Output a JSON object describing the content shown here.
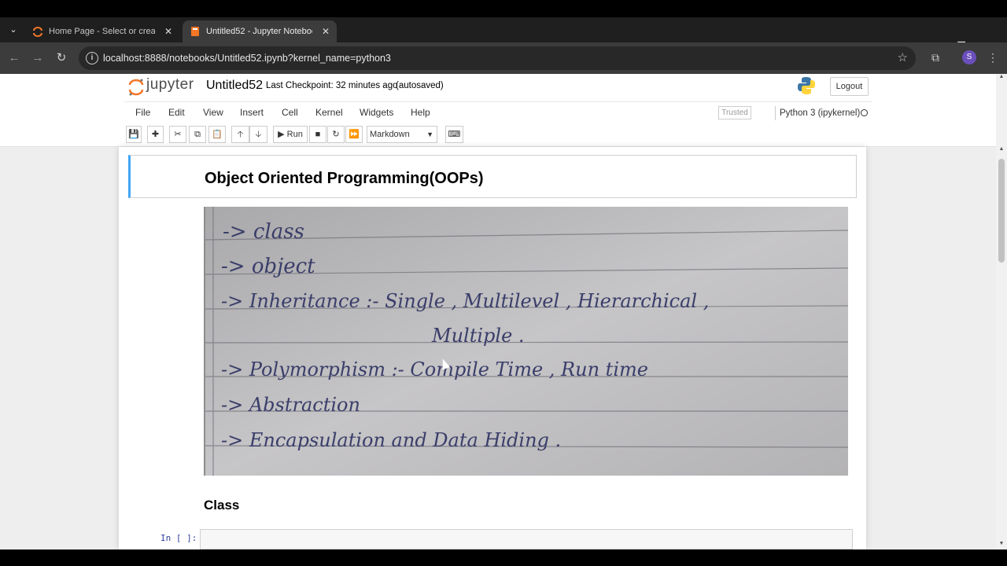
{
  "browser": {
    "tabs": [
      {
        "label": "Home Page - Select or create a notebook",
        "active": false
      },
      {
        "label": "Untitled52 - Jupyter Notebook",
        "active": true
      }
    ],
    "url": "localhost:8888/notebooks/Untitled52.ipynb?kernel_name=python3",
    "profile_initial": "S"
  },
  "jupyter": {
    "logo_text": "jupyter",
    "notebook_name": "Untitled52",
    "checkpoint": "Last Checkpoint: 32 minutes ago",
    "autosaved": "(autosaved)",
    "logout": "Logout",
    "menus": [
      "File",
      "Edit",
      "View",
      "Insert",
      "Cell",
      "Kernel",
      "Widgets",
      "Help"
    ],
    "trusted": "Trusted",
    "kernel": "Python 3 (ipykernel)",
    "run_label": "Run",
    "cell_type": "Markdown"
  },
  "cells": {
    "heading": "Object Oriented Programming(OOPs)",
    "notes_lines": [
      "-> class",
      "-> object",
      "-> Inheritance :- Single , Multilevel , Hierarchical ,",
      "Multiple .",
      "-> Polymorphism :- Compile Time , Run time",
      "-> Abstraction",
      "-> Encapsulation and Data Hiding ."
    ],
    "class_heading": "Class",
    "prompt": "In [ ]:"
  }
}
